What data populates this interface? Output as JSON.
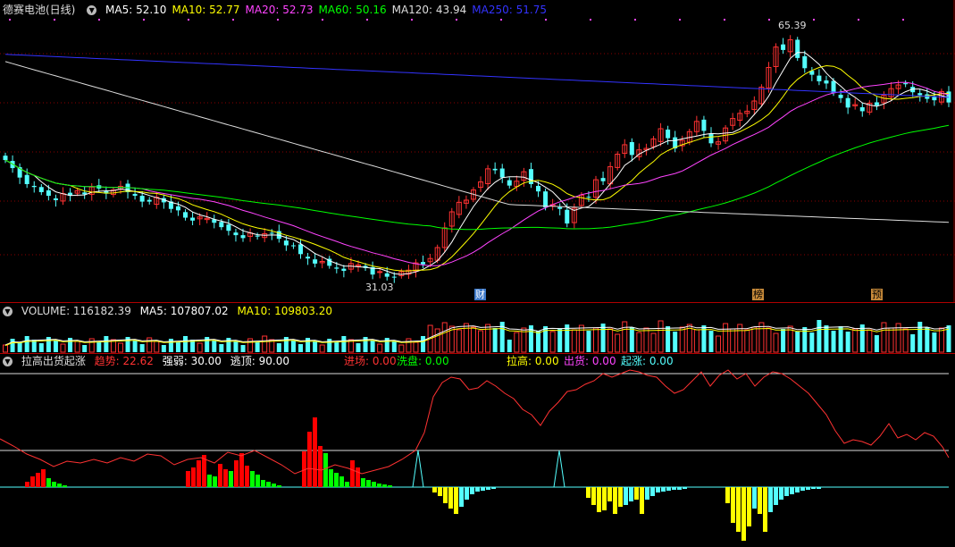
{
  "main": {
    "title": "德赛电池(日线)",
    "ma_labels": [
      {
        "text": "MA5: 52.10",
        "color": "#ffffff"
      },
      {
        "text": "MA10: 52.77",
        "color": "#ffff00"
      },
      {
        "text": "MA20: 52.73",
        "color": "#ff44ff"
      },
      {
        "text": "MA60: 50.16",
        "color": "#00ff00"
      },
      {
        "text": "MA120: 43.94",
        "color": "#dddddd"
      },
      {
        "text": "MA250: 51.75",
        "color": "#3333ff"
      }
    ],
    "high_label": "65.39",
    "low_label": "31.03",
    "markers": [
      {
        "text": "财",
        "style": "blue"
      },
      {
        "text": "榜",
        "style": "orange"
      },
      {
        "text": "预",
        "style": "orange"
      }
    ]
  },
  "volume": {
    "title": "VOLUME: 116182.39",
    "ma5": "MA5: 107807.02",
    "ma10": "MA10: 109803.20"
  },
  "indicator": {
    "title": "拉高出货起涨",
    "trend": "趋势: 22.62",
    "strength": "强弱: 30.00",
    "escape": "逃顶: 90.00",
    "enter": "进场: 0.00",
    "wash": "洗盘: 0.00",
    "pull": "拉高: 0.00",
    "ship": "出货: 0.00",
    "rise": "起涨: 0.00"
  },
  "colors": {
    "up": "#ff3232",
    "down": "#54ffff",
    "ma5": "#ffffff",
    "ma10": "#ffff00",
    "ma20": "#ff44ff",
    "ma60": "#00ff00",
    "ma120": "#dddddd",
    "ma250": "#3333ff",
    "trend_line": "#ff3232",
    "bar_red": "#ff0000",
    "bar_green": "#00ff00",
    "bar_yellow": "#ffff00",
    "bar_cyan": "#54ffff"
  },
  "chart_data": [
    {
      "type": "line",
      "name": "candlestick price",
      "high": 65.39,
      "low": 31.03,
      "closes": [
        47.5,
        46.4,
        45.1,
        44.2,
        43.8,
        43.1,
        42.6,
        42.0,
        42.9,
        42.6,
        43.3,
        42.8,
        43.8,
        43.6,
        42.9,
        43.4,
        43.9,
        43.1,
        42.6,
        41.8,
        41.8,
        42.4,
        41.7,
        40.8,
        40.6,
        39.6,
        39.2,
        39.7,
        39.5,
        38.9,
        38.3,
        37.8,
        37.2,
        36.8,
        37.5,
        37.0,
        37.4,
        37.4,
        36.7,
        35.8,
        35.7,
        34.6,
        34.0,
        33.3,
        33.6,
        33.0,
        32.6,
        32.3,
        33.3,
        33.1,
        32.7,
        31.8,
        32.2,
        31.5,
        31.4,
        32.2,
        32.4,
        33.4,
        33.2,
        34.0,
        35.5,
        38.2,
        40.4,
        41.7,
        42.0,
        43.4,
        44.5,
        46.3,
        46.1,
        45.1,
        44.0,
        44.6,
        45.9,
        44.2,
        43.2,
        41.0,
        41.4,
        40.8,
        38.8,
        40.9,
        42.7,
        42.4,
        44.8,
        44.6,
        46.6,
        48.3,
        49.6,
        48.2,
        48.9,
        49.1,
        50.4,
        51.8,
        50.5,
        49.1,
        50.2,
        51.4,
        52.8,
        51.5,
        49.8,
        50.0,
        51.9,
        53.2,
        53.9,
        54.2,
        55.6,
        57.5,
        60.2,
        63.0,
        62.6,
        64.0,
        61.5,
        60.1,
        59.2,
        58.3,
        58.0,
        56.7,
        56.0,
        54.7,
        55.1,
        54.2,
        55.3,
        55.0,
        56.4,
        57.3,
        57.8,
        57.9,
        56.8,
        56.4,
        55.9,
        55.7,
        56.9,
        55.4
      ]
    },
    {
      "type": "bar",
      "name": "VOLUME",
      "last": 116182.39
    },
    {
      "type": "bar",
      "name": "拉高出货起涨"
    }
  ]
}
